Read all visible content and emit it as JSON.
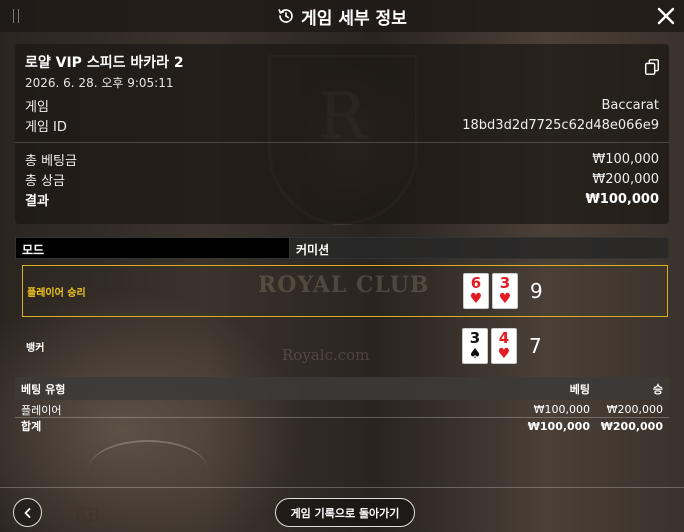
{
  "header": {
    "title": "게임 세부 정보"
  },
  "summary": {
    "title": "로얄 VIP 스피드 바카라 2",
    "date": "2026. 6. 28. 오후 9:05:11",
    "game_label": "게임",
    "game_value": "Baccarat",
    "game_id_label": "게임 ID",
    "game_id_value": "18bd3d2d7725c62d48e066e9",
    "total_bet_label": "총 베팅금",
    "total_bet_value": "₩100,000",
    "total_payout_label": "총 상금",
    "total_payout_value": "₩200,000",
    "result_label": "결과",
    "result_value": "₩100,000"
  },
  "mode_table": {
    "col1": "모드",
    "col2": "커미션"
  },
  "results": [
    {
      "label": "플레이어 승리",
      "score": "9",
      "cards": [
        {
          "rank": "6",
          "suit": "♥"
        },
        {
          "rank": "3",
          "suit": "♥"
        }
      ]
    },
    {
      "label": "뱅커",
      "score": "7",
      "cards": [
        {
          "rank": "3",
          "suit": "♠"
        },
        {
          "rank": "4",
          "suit": "♥"
        }
      ]
    }
  ],
  "bets_table": {
    "headers": {
      "type": "베팅 유형",
      "bet": "베팅",
      "win": "승"
    },
    "rows": [
      {
        "type": "플레이어",
        "bet": "₩100,000",
        "win": "₩200,000"
      },
      {
        "type": "합계",
        "bet": "₩100,000",
        "win": "₩200,000"
      }
    ]
  },
  "footer": {
    "history_button": "게임 기록으로 돌아가기"
  },
  "background": {
    "logo_letter": "R",
    "club_text": "ROYAL CLUB",
    "domain_text": "Royalc.com",
    "corner_text": "ER"
  },
  "colors": {
    "win_highlight": "#d8b21d",
    "card_red": "#e31b23"
  },
  "icons": {
    "header": "history-icon",
    "close": "close-icon",
    "copy": "copy-icon",
    "back": "chevron-left-icon"
  }
}
